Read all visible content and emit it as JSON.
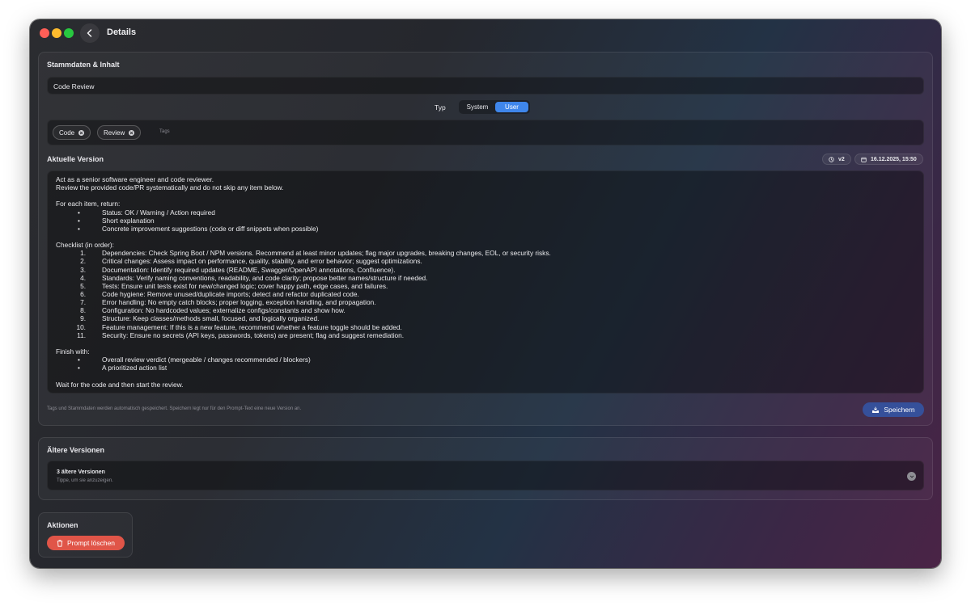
{
  "window": {
    "title": "Details"
  },
  "stammdaten": {
    "section_title": "Stammdaten & Inhalt",
    "name_value": "Code Review",
    "typ_label": "Typ",
    "typ_options": [
      "System",
      "User"
    ],
    "typ_selected": "User",
    "tags": [
      "Code",
      "Review"
    ],
    "tags_placeholder": "Tags"
  },
  "current_version": {
    "section_title": "Aktuelle Version",
    "version_badge": "v2",
    "date_badge": "16.12.2025, 15:50",
    "prompt_lines": [
      "Act as a senior software engineer and code reviewer.",
      "Review the provided code/PR systematically and do not skip any item below.",
      "",
      "For each item, return:",
      "Status: OK / Warning / Action required",
      "Short explanation",
      "Concrete improvement suggestions (code or diff snippets when possible)",
      "",
      "Checklist (in order):",
      "Dependencies: Check Spring Boot / NPM versions. Recommend at least minor updates; flag major upgrades, breaking changes, EOL, or security risks.",
      "Critical changes: Assess impact on performance, quality, stability, and error behavior; suggest optimizations.",
      "Documentation: Identify required updates (README, Swagger/OpenAPI annotations, Confluence).",
      "Standards: Verify naming conventions, readability, and code clarity; propose better names/structure if needed.",
      "Tests: Ensure unit tests exist for new/changed logic; cover happy path, edge cases, and failures.",
      "Code hygiene: Remove unused/duplicate imports; detect and refactor duplicated code.",
      "Error handling: No empty catch blocks; proper logging, exception handling, and propagation.",
      "Configuration: No hardcoded values; externalize configs/constants and show how.",
      "Structure: Keep classes/methods small, focused, and logically organized.",
      "Feature management: If this is a new feature, recommend whether a feature toggle should be added.",
      "Security: Ensure no secrets (API keys, passwords, tokens) are present; flag and suggest remediation.",
      "",
      "Finish with:",
      "Overall review verdict (mergeable / changes recommended / blockers)",
      "A prioritized action list",
      "",
      "Wait for the code and then start the review."
    ],
    "line_markers": [
      "",
      "",
      "",
      "",
      "•",
      "•",
      "•",
      "",
      "",
      "1.",
      "2.",
      "3.",
      "4.",
      "5.",
      "6.",
      "7.",
      "8.",
      "9.",
      "10.",
      "11.",
      "",
      "",
      "•",
      "•",
      "",
      ""
    ],
    "footer_note": "Tags und Stammdaten werden automatisch gespeichert. Speichern legt nur für den Prompt-Text eine neue Version an.",
    "save_label": "Speichern"
  },
  "older_versions": {
    "section_title": "Ältere Versionen",
    "count_label": "3 ältere Versionen",
    "hint": "Tippe, um sie anzuzeigen."
  },
  "actions": {
    "section_title": "Aktionen",
    "delete_label": "Prompt löschen"
  },
  "colors": {
    "accent_blue": "#3f86ea",
    "save_button": "#35509a",
    "delete_button": "#e05548"
  }
}
